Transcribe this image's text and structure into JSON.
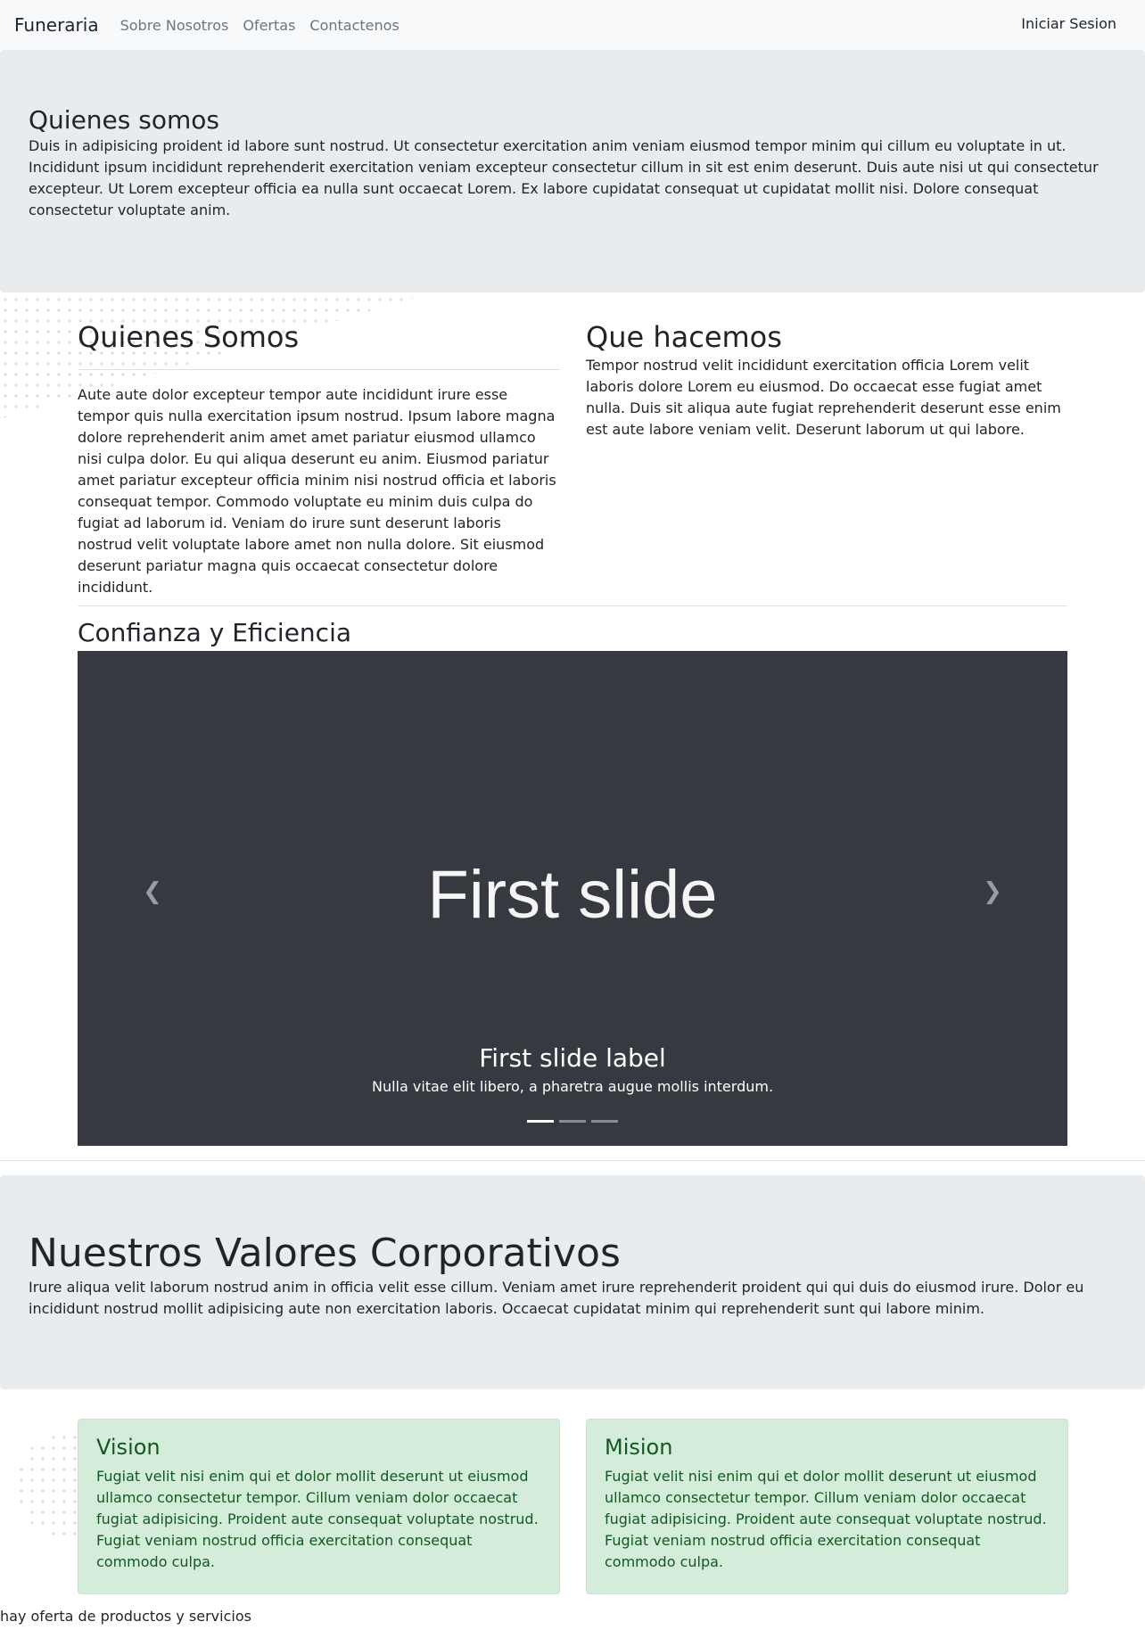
{
  "navbar": {
    "brand": "Funeraria",
    "links": [
      "Sobre Nosotros",
      "Ofertas",
      "Contactenos"
    ],
    "login": "Iniciar Sesion"
  },
  "hero": {
    "title": "Quienes somos",
    "text": "Duis in adipisicing proident id labore sunt nostrud. Ut consectetur exercitation anim veniam eiusmod tempor minim qui cillum eu voluptate in ut. Incididunt ipsum incididunt reprehenderit exercitation veniam excepteur consectetur cillum in sit est enim deserunt. Duis aute nisi ut qui consectetur excepteur. Ut Lorem excepteur officia ea nulla sunt occaecat Lorem. Ex labore cupidatat consequat ut cupidatat mollit nisi. Dolore consequat consectetur voluptate anim."
  },
  "about": {
    "title": "Quienes Somos",
    "text": "Aute aute dolor excepteur tempor aute incididunt irure esse tempor quis nulla exercitation ipsum nostrud. Ipsum labore magna dolore reprehenderit anim amet amet pariatur eiusmod ullamco nisi culpa dolor. Eu qui aliqua deserunt eu anim. Eiusmod pariatur amet pariatur excepteur officia minim nisi nostrud officia et laboris consequat tempor. Commodo voluptate eu minim duis culpa do fugiat ad laborum id. Veniam do irure sunt deserunt laboris nostrud velit voluptate labore amet non nulla dolore. Sit eiusmod deserunt pariatur magna quis occaecat consectetur dolore incididunt."
  },
  "what": {
    "title": "Que hacemos",
    "text": "Tempor nostrud velit incididunt exercitation officia Lorem velit laboris dolore Lorem eu eiusmod. Do occaecat esse fugiat amet nulla. Duis sit aliqua aute fugiat reprehenderit deserunt esse enim est aute labore veniam velit. Deserunt laborum ut qui labore."
  },
  "carousel": {
    "section_title": "Confianza y Eficiencia",
    "slide_text": "First slide",
    "caption_title": "First slide label",
    "caption_text": "Nulla vitae elit libero, a pharetra augue mollis interdum.",
    "prev_icon": "chevron-left-icon",
    "next_icon": "chevron-right-icon",
    "indicator_count": 3,
    "active_index": 0
  },
  "values": {
    "title": "Nuestros Valores Corporativos",
    "text": "Irure aliqua velit laborum nostrud anim in officia velit esse cillum. Veniam amet irure reprehenderit proident qui qui duis do eiusmod irure. Dolor eu incididunt nostrud mollit adipisicing aute non exercitation laboris. Occaecat cupidatat minim qui reprehenderit sunt qui labore minim."
  },
  "vision": {
    "title": "Vision",
    "text": "Fugiat velit nisi enim qui et dolor mollit deserunt ut eiusmod ullamco consectetur tempor. Cillum veniam dolor occaecat fugiat adipisicing. Proident aute consequat voluptate nostrud. Fugiat veniam nostrud officia exercitation consequat commodo culpa."
  },
  "mision": {
    "title": "Mision",
    "text": "Fugiat velit nisi enim qui et dolor mollit deserunt ut eiusmod ullamco consectetur tempor. Cillum veniam dolor occaecat fugiat adipisicing. Proident aute consequat voluptate nostrud. Fugiat veniam nostrud officia exercitation consequat commodo culpa."
  },
  "footer": {
    "text": "hay oferta de productos y servicios"
  },
  "colors": {
    "navbar_bg": "#f8f9fa",
    "jumbotron_bg": "#e9ecef",
    "carousel_bg": "#373940",
    "alert_bg": "#d4edda",
    "alert_text": "#155724"
  }
}
